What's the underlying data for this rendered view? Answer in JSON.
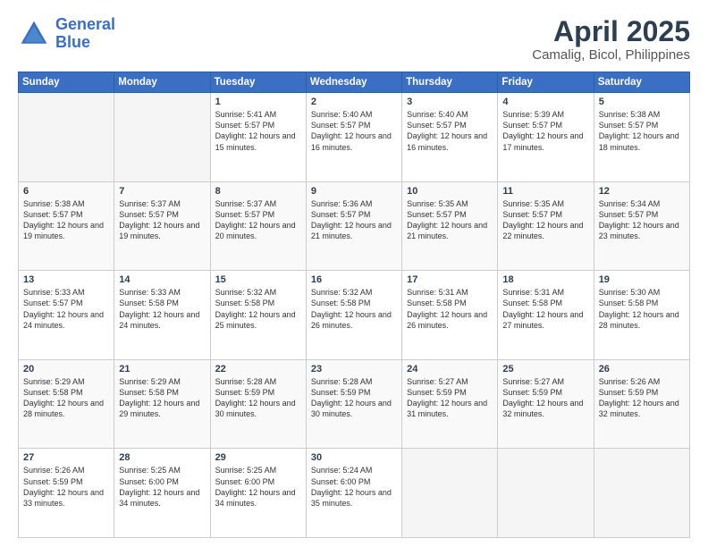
{
  "header": {
    "logo_line1": "General",
    "logo_line2": "Blue",
    "title": "April 2025",
    "subtitle": "Camalig, Bicol, Philippines"
  },
  "weekdays": [
    "Sunday",
    "Monday",
    "Tuesday",
    "Wednesday",
    "Thursday",
    "Friday",
    "Saturday"
  ],
  "weeks": [
    [
      {
        "day": "",
        "info": ""
      },
      {
        "day": "",
        "info": ""
      },
      {
        "day": "1",
        "info": "Sunrise: 5:41 AM\nSunset: 5:57 PM\nDaylight: 12 hours and 15 minutes."
      },
      {
        "day": "2",
        "info": "Sunrise: 5:40 AM\nSunset: 5:57 PM\nDaylight: 12 hours and 16 minutes."
      },
      {
        "day": "3",
        "info": "Sunrise: 5:40 AM\nSunset: 5:57 PM\nDaylight: 12 hours and 16 minutes."
      },
      {
        "day": "4",
        "info": "Sunrise: 5:39 AM\nSunset: 5:57 PM\nDaylight: 12 hours and 17 minutes."
      },
      {
        "day": "5",
        "info": "Sunrise: 5:38 AM\nSunset: 5:57 PM\nDaylight: 12 hours and 18 minutes."
      }
    ],
    [
      {
        "day": "6",
        "info": "Sunrise: 5:38 AM\nSunset: 5:57 PM\nDaylight: 12 hours and 19 minutes."
      },
      {
        "day": "7",
        "info": "Sunrise: 5:37 AM\nSunset: 5:57 PM\nDaylight: 12 hours and 19 minutes."
      },
      {
        "day": "8",
        "info": "Sunrise: 5:37 AM\nSunset: 5:57 PM\nDaylight: 12 hours and 20 minutes."
      },
      {
        "day": "9",
        "info": "Sunrise: 5:36 AM\nSunset: 5:57 PM\nDaylight: 12 hours and 21 minutes."
      },
      {
        "day": "10",
        "info": "Sunrise: 5:35 AM\nSunset: 5:57 PM\nDaylight: 12 hours and 21 minutes."
      },
      {
        "day": "11",
        "info": "Sunrise: 5:35 AM\nSunset: 5:57 PM\nDaylight: 12 hours and 22 minutes."
      },
      {
        "day": "12",
        "info": "Sunrise: 5:34 AM\nSunset: 5:57 PM\nDaylight: 12 hours and 23 minutes."
      }
    ],
    [
      {
        "day": "13",
        "info": "Sunrise: 5:33 AM\nSunset: 5:57 PM\nDaylight: 12 hours and 24 minutes."
      },
      {
        "day": "14",
        "info": "Sunrise: 5:33 AM\nSunset: 5:58 PM\nDaylight: 12 hours and 24 minutes."
      },
      {
        "day": "15",
        "info": "Sunrise: 5:32 AM\nSunset: 5:58 PM\nDaylight: 12 hours and 25 minutes."
      },
      {
        "day": "16",
        "info": "Sunrise: 5:32 AM\nSunset: 5:58 PM\nDaylight: 12 hours and 26 minutes."
      },
      {
        "day": "17",
        "info": "Sunrise: 5:31 AM\nSunset: 5:58 PM\nDaylight: 12 hours and 26 minutes."
      },
      {
        "day": "18",
        "info": "Sunrise: 5:31 AM\nSunset: 5:58 PM\nDaylight: 12 hours and 27 minutes."
      },
      {
        "day": "19",
        "info": "Sunrise: 5:30 AM\nSunset: 5:58 PM\nDaylight: 12 hours and 28 minutes."
      }
    ],
    [
      {
        "day": "20",
        "info": "Sunrise: 5:29 AM\nSunset: 5:58 PM\nDaylight: 12 hours and 28 minutes."
      },
      {
        "day": "21",
        "info": "Sunrise: 5:29 AM\nSunset: 5:58 PM\nDaylight: 12 hours and 29 minutes."
      },
      {
        "day": "22",
        "info": "Sunrise: 5:28 AM\nSunset: 5:59 PM\nDaylight: 12 hours and 30 minutes."
      },
      {
        "day": "23",
        "info": "Sunrise: 5:28 AM\nSunset: 5:59 PM\nDaylight: 12 hours and 30 minutes."
      },
      {
        "day": "24",
        "info": "Sunrise: 5:27 AM\nSunset: 5:59 PM\nDaylight: 12 hours and 31 minutes."
      },
      {
        "day": "25",
        "info": "Sunrise: 5:27 AM\nSunset: 5:59 PM\nDaylight: 12 hours and 32 minutes."
      },
      {
        "day": "26",
        "info": "Sunrise: 5:26 AM\nSunset: 5:59 PM\nDaylight: 12 hours and 32 minutes."
      }
    ],
    [
      {
        "day": "27",
        "info": "Sunrise: 5:26 AM\nSunset: 5:59 PM\nDaylight: 12 hours and 33 minutes."
      },
      {
        "day": "28",
        "info": "Sunrise: 5:25 AM\nSunset: 6:00 PM\nDaylight: 12 hours and 34 minutes."
      },
      {
        "day": "29",
        "info": "Sunrise: 5:25 AM\nSunset: 6:00 PM\nDaylight: 12 hours and 34 minutes."
      },
      {
        "day": "30",
        "info": "Sunrise: 5:24 AM\nSunset: 6:00 PM\nDaylight: 12 hours and 35 minutes."
      },
      {
        "day": "",
        "info": ""
      },
      {
        "day": "",
        "info": ""
      },
      {
        "day": "",
        "info": ""
      }
    ]
  ]
}
